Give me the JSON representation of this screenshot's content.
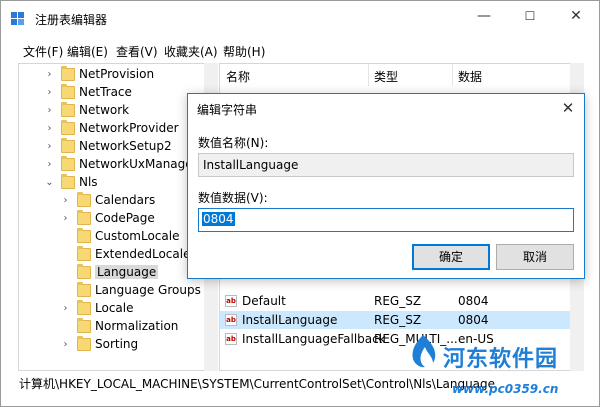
{
  "window": {
    "title": "注册表编辑器",
    "minimize": "—",
    "maximize": "☐",
    "close": "✕"
  },
  "menu": [
    "文件(F)",
    "编辑(E)",
    "查看(V)",
    "收藏夹(A)",
    "帮助(H)"
  ],
  "tree": [
    {
      "label": "NetProvision",
      "toggle": "›",
      "level": 1
    },
    {
      "label": "NetTrace",
      "toggle": "›",
      "level": 1
    },
    {
      "label": "Network",
      "toggle": "›",
      "level": 1
    },
    {
      "label": "NetworkProvider",
      "toggle": "›",
      "level": 1
    },
    {
      "label": "NetworkSetup2",
      "toggle": "›",
      "level": 1
    },
    {
      "label": "NetworkUxManager",
      "toggle": "›",
      "level": 1
    },
    {
      "label": "Nls",
      "toggle": "⌄",
      "level": 1
    },
    {
      "label": "Calendars",
      "toggle": "›",
      "level": 2
    },
    {
      "label": "CodePage",
      "toggle": "›",
      "level": 2
    },
    {
      "label": "CustomLocale",
      "toggle": "",
      "level": 2
    },
    {
      "label": "ExtendedLocale",
      "toggle": "",
      "level": 2
    },
    {
      "label": "Language",
      "toggle": "",
      "level": 2,
      "selected": true
    },
    {
      "label": "Language Groups",
      "toggle": "",
      "level": 2
    },
    {
      "label": "Locale",
      "toggle": "›",
      "level": 2
    },
    {
      "label": "Normalization",
      "toggle": "",
      "level": 2
    },
    {
      "label": "Sorting",
      "toggle": "›",
      "level": 2
    }
  ],
  "values_header": {
    "name": "名称",
    "type": "类型",
    "data": "数据"
  },
  "values": [
    {
      "name": "Default",
      "type": "REG_SZ",
      "data": "0804",
      "icon": "ab"
    },
    {
      "name": "InstallLanguage",
      "type": "REG_SZ",
      "data": "0804",
      "icon": "ab",
      "selected": true
    },
    {
      "name": "InstallLanguageFallback",
      "type": "REG_MULTI_...",
      "data": "en-US",
      "icon": "ab"
    }
  ],
  "status": "计算机\\HKEY_LOCAL_MACHINE\\SYSTEM\\CurrentControlSet\\Control\\Nls\\Language",
  "dialog": {
    "title": "编辑字符串",
    "name_label": "数值名称(N):",
    "name_value": "InstallLanguage",
    "data_label": "数值数据(V):",
    "data_value": "0804",
    "ok_label": "确定",
    "cancel_label": "取消"
  },
  "watermark": {
    "brand": "河东软件园",
    "url": "www.pc0359.cn"
  },
  "colors": {
    "accent": "#0078d7",
    "folder": "#f8d775",
    "selected_row": "#cce8ff",
    "watermark": "#1f7ed6"
  }
}
